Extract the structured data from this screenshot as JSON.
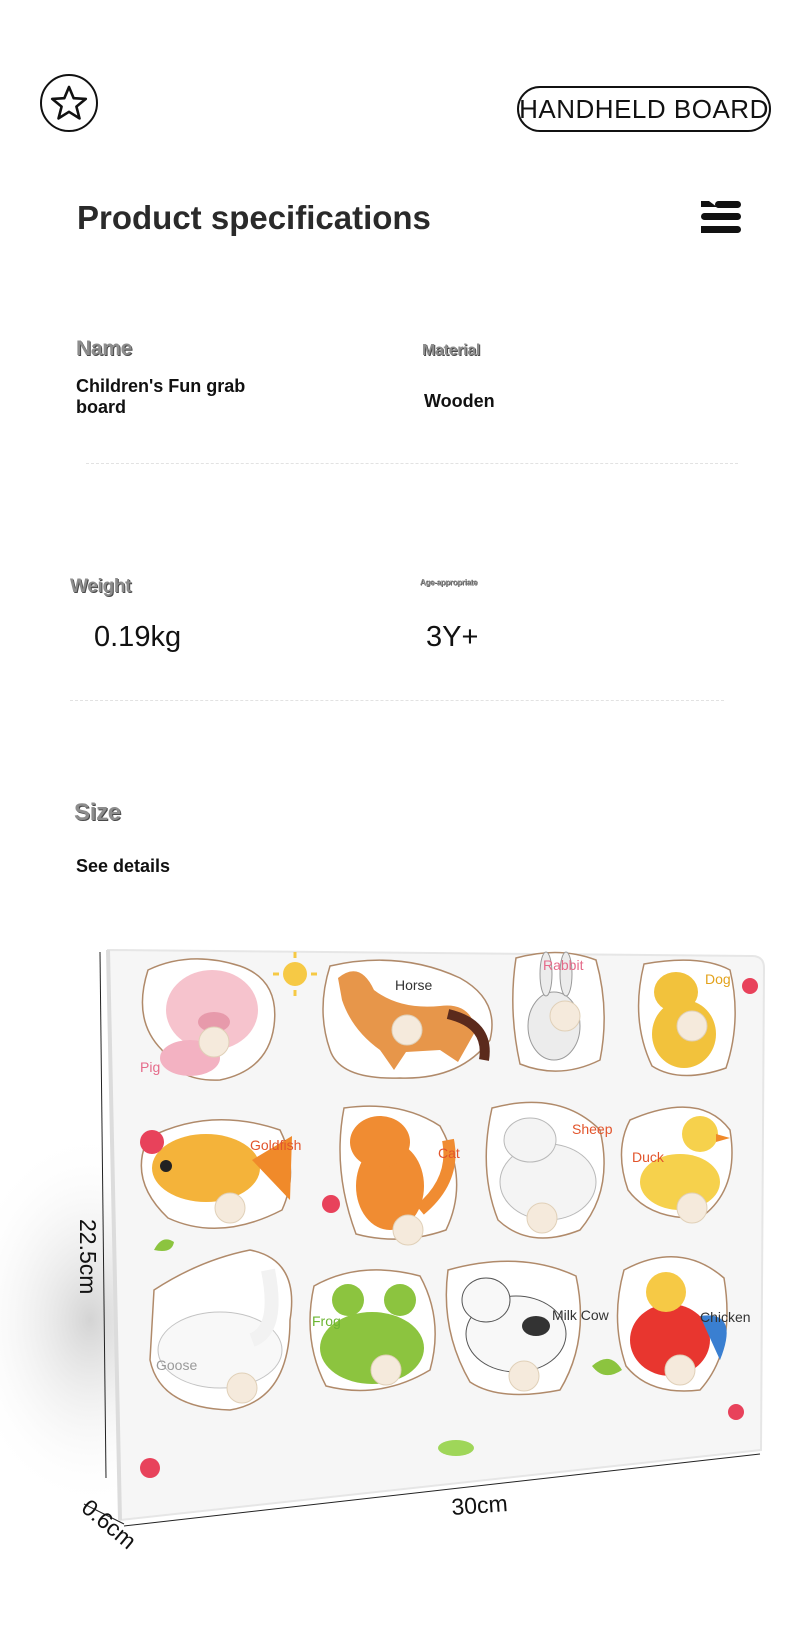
{
  "header": {
    "badge_label": "HANDHELD BOARD"
  },
  "section_title": "Product specifications",
  "specs": {
    "name_label": "Name",
    "name_value": "Children's Fun grab board",
    "material_label": "Material",
    "material_value": "Wooden",
    "weight_label": "Weight",
    "weight_value": "0.19kg",
    "age_label": "Age-appropriate",
    "age_value": "3Y+",
    "size_label": "Size",
    "size_value": "See details"
  },
  "dimensions": {
    "height": "22.5cm",
    "width": "30cm",
    "thickness": "0.6cm"
  },
  "board_labels": {
    "pig": "Pig",
    "horse": "Horse",
    "rabbit": "Rabbit",
    "dog": "Dog",
    "goldfish": "Goldfish",
    "cat": "Cat",
    "sheep": "Sheep",
    "duck": "Duck",
    "goose": "Goose",
    "frog": "Frog",
    "milk_cow": "Milk Cow",
    "chicken": "Chicken"
  },
  "icons": {
    "badge": "star-icon",
    "menu": "list-icon"
  },
  "colors": {
    "text": "#111111",
    "label_gray": "#8d8d8d",
    "board": "#f6f6f6"
  }
}
